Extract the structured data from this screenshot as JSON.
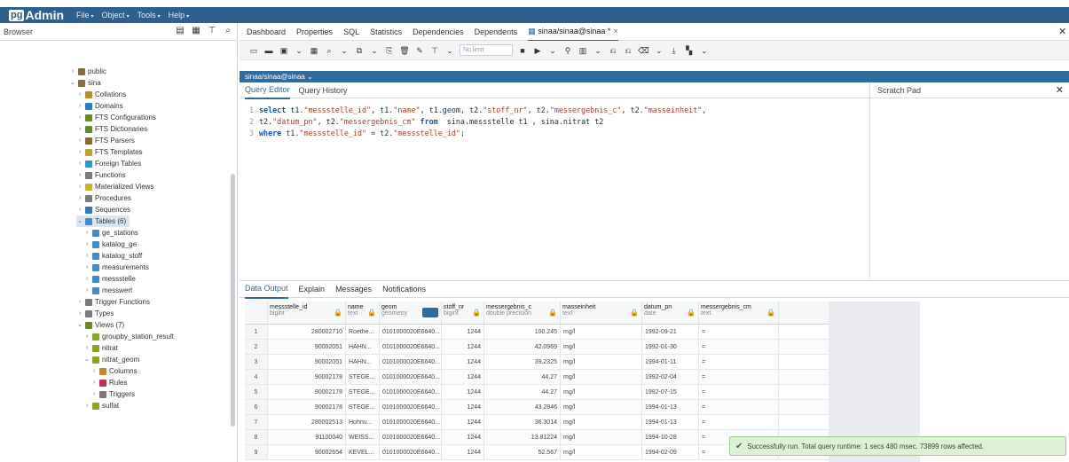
{
  "app": {
    "logo_pg": "pg",
    "logo_admin": "Admin",
    "menus": [
      {
        "label": "File"
      },
      {
        "label": "Object"
      },
      {
        "label": "Tools"
      },
      {
        "label": "Help"
      }
    ]
  },
  "browser": {
    "title": "Browser",
    "tree": [
      {
        "label": "public",
        "indent": 1,
        "twisty": "›",
        "icon": "schema-icon",
        "color": "#8a6d3b"
      },
      {
        "label": "sina",
        "indent": 1,
        "twisty": "⌄",
        "icon": "schema-icon",
        "color": "#8a6d3b"
      },
      {
        "label": "Collations",
        "indent": 2,
        "twisty": "›",
        "icon": "collation-icon",
        "color": "#c48a2a"
      },
      {
        "label": "Domains",
        "indent": 2,
        "twisty": "›",
        "icon": "domain-icon",
        "color": "#2a7ac4"
      },
      {
        "label": "FTS Configurations",
        "indent": 2,
        "twisty": "›",
        "icon": "fts-config-icon",
        "color": "#6a8a2a"
      },
      {
        "label": "FTS Dictionaries",
        "indent": 2,
        "twisty": "›",
        "icon": "fts-dict-icon",
        "color": "#6a8a2a"
      },
      {
        "label": "FTS Parsers",
        "indent": 2,
        "twisty": "›",
        "icon": "fts-parser-icon",
        "color": "#8a6a2a"
      },
      {
        "label": "FTS Templates",
        "indent": 2,
        "twisty": "›",
        "icon": "fts-template-icon",
        "color": "#c4a22a"
      },
      {
        "label": "Foreign Tables",
        "indent": 2,
        "twisty": "›",
        "icon": "foreign-table-icon",
        "color": "#2a9ac4"
      },
      {
        "label": "Functions",
        "indent": 2,
        "twisty": "›",
        "icon": "function-icon",
        "color": "#7a7a7a"
      },
      {
        "label": "Materialized Views",
        "indent": 2,
        "twisty": "›",
        "icon": "matview-icon",
        "color": "#c4b42a"
      },
      {
        "label": "Procedures",
        "indent": 2,
        "twisty": "›",
        "icon": "procedure-icon",
        "color": "#7a7a7a"
      },
      {
        "label": "Sequences",
        "indent": 2,
        "twisty": "›",
        "icon": "sequence-icon",
        "color": "#2a7ac4"
      },
      {
        "label": "Tables (6)",
        "indent": 2,
        "twisty": "⌄",
        "icon": "tables-icon",
        "color": "#4a8ac4",
        "selected": true
      },
      {
        "label": "ge_stations",
        "indent": 3,
        "twisty": "›",
        "icon": "table-icon",
        "color": "#4a8ac4"
      },
      {
        "label": "katalog_ge",
        "indent": 3,
        "twisty": "›",
        "icon": "table-icon",
        "color": "#4a8ac4"
      },
      {
        "label": "katalog_stoff",
        "indent": 3,
        "twisty": "›",
        "icon": "table-icon",
        "color": "#4a8ac4"
      },
      {
        "label": "measurements",
        "indent": 3,
        "twisty": "›",
        "icon": "table-icon",
        "color": "#4a8ac4"
      },
      {
        "label": "messstelle",
        "indent": 3,
        "twisty": "›",
        "icon": "table-icon",
        "color": "#4a8ac4"
      },
      {
        "label": "messwert",
        "indent": 3,
        "twisty": "›",
        "icon": "table-icon",
        "color": "#4a8ac4"
      },
      {
        "label": "Trigger Functions",
        "indent": 2,
        "twisty": "›",
        "icon": "trigger-function-icon",
        "color": "#7a7a7a"
      },
      {
        "label": "Types",
        "indent": 2,
        "twisty": "›",
        "icon": "type-icon",
        "color": "#7a7a7a"
      },
      {
        "label": "Views (7)",
        "indent": 2,
        "twisty": "⌄",
        "icon": "views-icon",
        "color": "#6a8a2a"
      },
      {
        "label": "groupby_station_result",
        "indent": 3,
        "twisty": "›",
        "icon": "view-icon",
        "color": "#8aa42a"
      },
      {
        "label": "nitrat",
        "indent": 3,
        "twisty": "›",
        "icon": "view-icon",
        "color": "#8aa42a"
      },
      {
        "label": "nitrat_geom",
        "indent": 3,
        "twisty": "⌄",
        "icon": "view-icon",
        "color": "#8aa42a"
      },
      {
        "label": "Columns",
        "indent": 4,
        "twisty": "›",
        "icon": "columns-icon",
        "color": "#c48a2a"
      },
      {
        "label": "Rules",
        "indent": 4,
        "twisty": "›",
        "icon": "rules-icon",
        "color": "#c42a6a"
      },
      {
        "label": "Triggers",
        "indent": 4,
        "twisty": "›",
        "icon": "triggers-icon",
        "color": "#7a7a7a"
      },
      {
        "label": "sulfat",
        "indent": 3,
        "twisty": "›",
        "icon": "view-icon",
        "color": "#8aa42a"
      }
    ]
  },
  "tabs": [
    {
      "label": "Dashboard"
    },
    {
      "label": "Properties"
    },
    {
      "label": "SQL"
    },
    {
      "label": "Statistics"
    },
    {
      "label": "Dependencies"
    },
    {
      "label": "Dependents"
    },
    {
      "label": "sinaa/sinaa@sinaa *",
      "active": true
    }
  ],
  "toolbar": {
    "sql_select_placeholder": "No limit"
  },
  "connection": {
    "label": "sinaa/sinaa@sinaa ⌄"
  },
  "editor": {
    "tabs": [
      "Query Editor",
      "Query History"
    ],
    "scratch_pad": "Scratch Pad",
    "lines": [
      {
        "n": "1",
        "parts": [
          {
            "t": "kw",
            "v": "select "
          },
          {
            "t": "plain",
            "v": "t1."
          },
          {
            "t": "str",
            "v": "\"messstelle_id\""
          },
          {
            "t": "plain",
            "v": ", t1."
          },
          {
            "t": "str",
            "v": "\"name\""
          },
          {
            "t": "plain",
            "v": ", t1.geom, t2."
          },
          {
            "t": "str",
            "v": "\"stoff_nr\""
          },
          {
            "t": "plain",
            "v": ", t2."
          },
          {
            "t": "str",
            "v": "\"messergebnis_c\""
          },
          {
            "t": "plain",
            "v": ", t2."
          },
          {
            "t": "str",
            "v": "\"masseinheit\""
          },
          {
            "t": "plain",
            "v": ","
          }
        ]
      },
      {
        "n": "2",
        "parts": [
          {
            "t": "plain",
            "v": "t2."
          },
          {
            "t": "str",
            "v": "\"datum_pn\""
          },
          {
            "t": "plain",
            "v": ", t2."
          },
          {
            "t": "str",
            "v": "\"messergebnis_cm\""
          },
          {
            "t": "plain",
            "v": " "
          },
          {
            "t": "kw",
            "v": "from"
          },
          {
            "t": "plain",
            "v": "  sina.messstelle t1 , sina.nitrat t2"
          }
        ]
      },
      {
        "n": "3",
        "parts": [
          {
            "t": "kw",
            "v": "where "
          },
          {
            "t": "plain",
            "v": "t1."
          },
          {
            "t": "str",
            "v": "\"messstelle_id\""
          },
          {
            "t": "plain",
            "v": " = t2."
          },
          {
            "t": "str",
            "v": "\"messstelle_id\""
          },
          {
            "t": "plain",
            "v": ";"
          }
        ]
      }
    ]
  },
  "output": {
    "tabs": [
      "Data Output",
      "Explain",
      "Messages",
      "Notifications"
    ],
    "columns": [
      {
        "name": "messstelle_id",
        "type": "bigint"
      },
      {
        "name": "name",
        "type": "text"
      },
      {
        "name": "geom",
        "type": "geometry"
      },
      {
        "name": "stoff_nr",
        "type": "bigint"
      },
      {
        "name": "messergebnis_c",
        "type": "double precision"
      },
      {
        "name": "masseinheit",
        "type": "text"
      },
      {
        "name": "datum_pn",
        "type": "date"
      },
      {
        "name": "messergebnis_cm",
        "type": "text"
      }
    ],
    "rows": [
      [
        "1",
        "280002710",
        "Roethe...",
        "0101000020E6640...",
        "1244",
        "100.245",
        "mg/l",
        "1992-09-21",
        "="
      ],
      [
        "2",
        "90002051",
        "HAHN...",
        "0101000020E6640...",
        "1244",
        "42.0969",
        "mg/l",
        "1992-01-30",
        "="
      ],
      [
        "3",
        "90002051",
        "HAHN...",
        "0101000020E6640...",
        "1244",
        "39.2325",
        "mg/l",
        "1994-01-11",
        "="
      ],
      [
        "4",
        "90002178",
        "STEGE...",
        "0101000020E6640...",
        "1244",
        "44.27",
        "mg/l",
        "1992-02-04",
        "="
      ],
      [
        "5",
        "90002178",
        "STEGE...",
        "0101000020E6640...",
        "1244",
        "44.27",
        "mg/l",
        "1992-07-15",
        "="
      ],
      [
        "6",
        "90002178",
        "STEGE...",
        "0101000020E6640...",
        "1244",
        "43.2846",
        "mg/l",
        "1994-01-13",
        "="
      ],
      [
        "7",
        "280002513",
        "Hohnu...",
        "0101000020E6640...",
        "1244",
        "36.3014",
        "mg/l",
        "1994-01-13",
        "="
      ],
      [
        "8",
        "91100040",
        "WEISS...",
        "0101000020E6640...",
        "1244",
        "13.81224",
        "mg/l",
        "1994-10-28",
        "="
      ],
      [
        "9",
        "90002654",
        "KEVEL...",
        "0101000020E6640...",
        "1244",
        "52.567",
        "mg/l",
        "1994-02-09",
        "="
      ]
    ]
  },
  "toast": {
    "message": "Successfully run. Total query runtime: 1 secs 480 msec. 73899 rows affected."
  }
}
